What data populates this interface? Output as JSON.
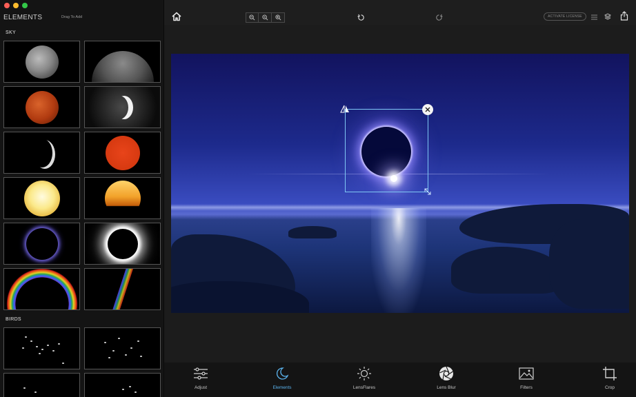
{
  "sidebar": {
    "title": "ELEMENTS",
    "hint": "Drag To Add",
    "sections": [
      {
        "label": "SKY"
      },
      {
        "label": "BIRDS"
      }
    ]
  },
  "toolbar": {
    "license_label": "ACTIVATE LICENSE",
    "icons": [
      "home-icon",
      "zoom-out-icon",
      "zoom-fit-icon",
      "zoom-in-icon",
      "undo-icon",
      "redo-icon",
      "list-icon",
      "layers-icon",
      "share-icon"
    ]
  },
  "tabs": [
    {
      "label": "Adjust",
      "icon": "sliders-icon"
    },
    {
      "label": "Elements",
      "icon": "moon-icon",
      "active": true
    },
    {
      "label": "LensFlares",
      "icon": "sun-icon"
    },
    {
      "label": "Lens Blur",
      "icon": "aperture-icon"
    },
    {
      "label": "Filters",
      "icon": "image-icon"
    },
    {
      "label": "Crop",
      "icon": "crop-icon"
    }
  ],
  "colors": {
    "accent": "#5bb5f0",
    "selection": "#7fc8f4",
    "background": "#1c1c1c"
  }
}
